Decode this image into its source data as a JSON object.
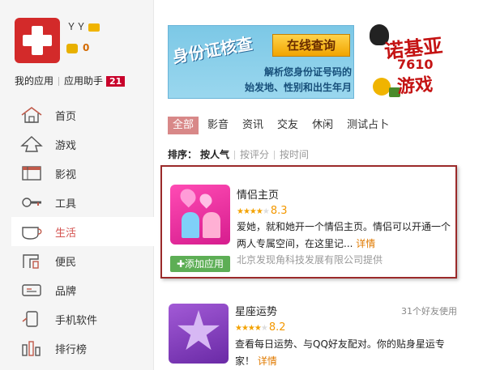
{
  "profile": {
    "username": "ＹＹ",
    "coins": "0"
  },
  "user_links": {
    "my_apps": "我的应用",
    "helper": "应用助手",
    "helper_badge": "21"
  },
  "nav": [
    {
      "label": "首页",
      "icon": "home-icon"
    },
    {
      "label": "游戏",
      "icon": "game-icon"
    },
    {
      "label": "影视",
      "icon": "film-icon"
    },
    {
      "label": "工具",
      "icon": "tool-icon"
    },
    {
      "label": "生活",
      "icon": "life-icon",
      "active": true
    },
    {
      "label": "便民",
      "icon": "convenience-icon"
    },
    {
      "label": "品牌",
      "icon": "brand-icon"
    },
    {
      "label": "手机软件",
      "icon": "phone-software-icon"
    },
    {
      "label": "排行榜",
      "icon": "ranking-icon"
    }
  ],
  "banner1": {
    "title": "身份证核查",
    "button": "在线查询",
    "desc_line1": "解析您身份证号码的",
    "desc_line2": "始发地、性别和出生年月"
  },
  "banner2": {
    "line1": "诺基亚",
    "line2": "7610",
    "line3": "游戏"
  },
  "tabs": [
    "全部",
    "影音",
    "资讯",
    "交友",
    "休闲",
    "测试占卜"
  ],
  "sort": {
    "label": "排序：",
    "active": "按人气",
    "option2": "按评分",
    "option3": "按时间"
  },
  "apps": [
    {
      "name": "情侣主页",
      "stars": 4,
      "score": "8.3",
      "desc": "爱她，就和她开一个情侣主页。情侣可以开通一个两人专属空间，在这里记...",
      "more": "详情",
      "provider": "北京发现角科技发展有限公司提供",
      "add_label": "添加应用"
    },
    {
      "name": "星座运势",
      "friends": "31个好友使用",
      "stars": 4,
      "score": "8.2",
      "desc": "查看每日运势、与QQ好友配对。你的贴身星运专家！",
      "more": "详情"
    }
  ],
  "colors": {
    "active_tab_bg": "#d88888",
    "accent_red": "#d4524f",
    "card_border": "#9b2a2a",
    "add_button": "#5dae55",
    "score": "#f39800"
  }
}
